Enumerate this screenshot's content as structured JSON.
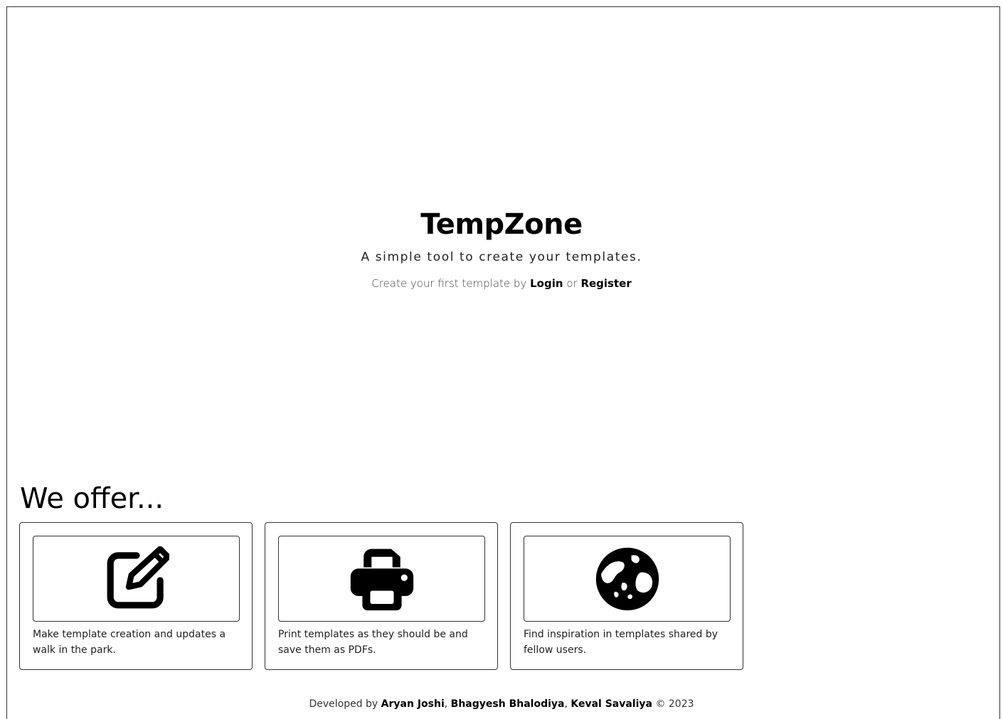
{
  "hero": {
    "title": "TempZone",
    "subtitle": "A simple tool to create your templates.",
    "cta_prefix": "Create your first template by",
    "login_label": "Login",
    "cta_or": "or",
    "register_label": "Register"
  },
  "offer": {
    "heading": "We offer...",
    "cards": [
      {
        "icon": "edit-icon",
        "text": "Make template creation and updates a walk in the park."
      },
      {
        "icon": "printer-icon",
        "text": "Print templates as they should be and save them as PDFs."
      },
      {
        "icon": "globe-icon",
        "text": "Find inspiration in templates shared by fellow users."
      }
    ]
  },
  "footer": {
    "prefix": "Developed by",
    "dev1": "Aryan Joshi",
    "sep1": ",",
    "dev2": "Bhagyesh Bhalodiya",
    "sep2": ",",
    "dev3": "Keval Savaliya",
    "suffix": "© 2023"
  }
}
